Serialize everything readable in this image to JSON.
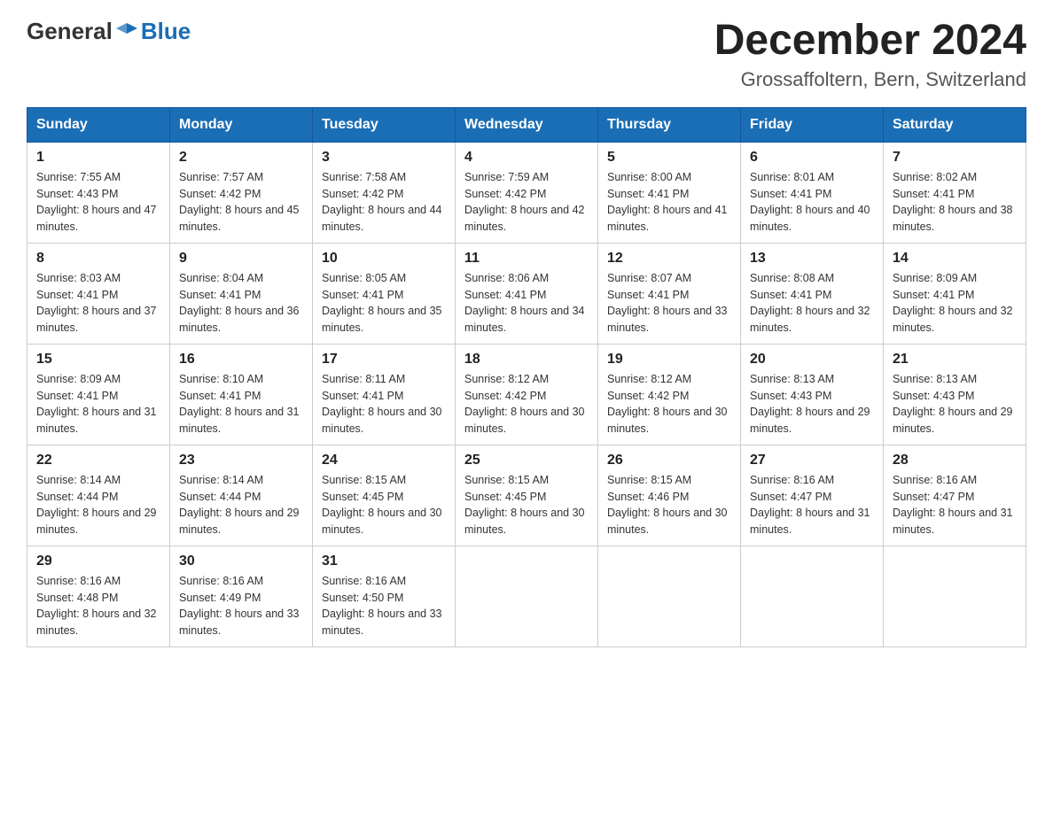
{
  "header": {
    "logo_general": "General",
    "logo_blue": "Blue",
    "month_title": "December 2024",
    "location": "Grossaffoltern, Bern, Switzerland"
  },
  "weekdays": [
    "Sunday",
    "Monday",
    "Tuesday",
    "Wednesday",
    "Thursday",
    "Friday",
    "Saturday"
  ],
  "weeks": [
    [
      {
        "day": "1",
        "sunrise": "7:55 AM",
        "sunset": "4:43 PM",
        "daylight": "8 hours and 47 minutes."
      },
      {
        "day": "2",
        "sunrise": "7:57 AM",
        "sunset": "4:42 PM",
        "daylight": "8 hours and 45 minutes."
      },
      {
        "day": "3",
        "sunrise": "7:58 AM",
        "sunset": "4:42 PM",
        "daylight": "8 hours and 44 minutes."
      },
      {
        "day": "4",
        "sunrise": "7:59 AM",
        "sunset": "4:42 PM",
        "daylight": "8 hours and 42 minutes."
      },
      {
        "day": "5",
        "sunrise": "8:00 AM",
        "sunset": "4:41 PM",
        "daylight": "8 hours and 41 minutes."
      },
      {
        "day": "6",
        "sunrise": "8:01 AM",
        "sunset": "4:41 PM",
        "daylight": "8 hours and 40 minutes."
      },
      {
        "day": "7",
        "sunrise": "8:02 AM",
        "sunset": "4:41 PM",
        "daylight": "8 hours and 38 minutes."
      }
    ],
    [
      {
        "day": "8",
        "sunrise": "8:03 AM",
        "sunset": "4:41 PM",
        "daylight": "8 hours and 37 minutes."
      },
      {
        "day": "9",
        "sunrise": "8:04 AM",
        "sunset": "4:41 PM",
        "daylight": "8 hours and 36 minutes."
      },
      {
        "day": "10",
        "sunrise": "8:05 AM",
        "sunset": "4:41 PM",
        "daylight": "8 hours and 35 minutes."
      },
      {
        "day": "11",
        "sunrise": "8:06 AM",
        "sunset": "4:41 PM",
        "daylight": "8 hours and 34 minutes."
      },
      {
        "day": "12",
        "sunrise": "8:07 AM",
        "sunset": "4:41 PM",
        "daylight": "8 hours and 33 minutes."
      },
      {
        "day": "13",
        "sunrise": "8:08 AM",
        "sunset": "4:41 PM",
        "daylight": "8 hours and 32 minutes."
      },
      {
        "day": "14",
        "sunrise": "8:09 AM",
        "sunset": "4:41 PM",
        "daylight": "8 hours and 32 minutes."
      }
    ],
    [
      {
        "day": "15",
        "sunrise": "8:09 AM",
        "sunset": "4:41 PM",
        "daylight": "8 hours and 31 minutes."
      },
      {
        "day": "16",
        "sunrise": "8:10 AM",
        "sunset": "4:41 PM",
        "daylight": "8 hours and 31 minutes."
      },
      {
        "day": "17",
        "sunrise": "8:11 AM",
        "sunset": "4:41 PM",
        "daylight": "8 hours and 30 minutes."
      },
      {
        "day": "18",
        "sunrise": "8:12 AM",
        "sunset": "4:42 PM",
        "daylight": "8 hours and 30 minutes."
      },
      {
        "day": "19",
        "sunrise": "8:12 AM",
        "sunset": "4:42 PM",
        "daylight": "8 hours and 30 minutes."
      },
      {
        "day": "20",
        "sunrise": "8:13 AM",
        "sunset": "4:43 PM",
        "daylight": "8 hours and 29 minutes."
      },
      {
        "day": "21",
        "sunrise": "8:13 AM",
        "sunset": "4:43 PM",
        "daylight": "8 hours and 29 minutes."
      }
    ],
    [
      {
        "day": "22",
        "sunrise": "8:14 AM",
        "sunset": "4:44 PM",
        "daylight": "8 hours and 29 minutes."
      },
      {
        "day": "23",
        "sunrise": "8:14 AM",
        "sunset": "4:44 PM",
        "daylight": "8 hours and 29 minutes."
      },
      {
        "day": "24",
        "sunrise": "8:15 AM",
        "sunset": "4:45 PM",
        "daylight": "8 hours and 30 minutes."
      },
      {
        "day": "25",
        "sunrise": "8:15 AM",
        "sunset": "4:45 PM",
        "daylight": "8 hours and 30 minutes."
      },
      {
        "day": "26",
        "sunrise": "8:15 AM",
        "sunset": "4:46 PM",
        "daylight": "8 hours and 30 minutes."
      },
      {
        "day": "27",
        "sunrise": "8:16 AM",
        "sunset": "4:47 PM",
        "daylight": "8 hours and 31 minutes."
      },
      {
        "day": "28",
        "sunrise": "8:16 AM",
        "sunset": "4:47 PM",
        "daylight": "8 hours and 31 minutes."
      }
    ],
    [
      {
        "day": "29",
        "sunrise": "8:16 AM",
        "sunset": "4:48 PM",
        "daylight": "8 hours and 32 minutes."
      },
      {
        "day": "30",
        "sunrise": "8:16 AM",
        "sunset": "4:49 PM",
        "daylight": "8 hours and 33 minutes."
      },
      {
        "day": "31",
        "sunrise": "8:16 AM",
        "sunset": "4:50 PM",
        "daylight": "8 hours and 33 minutes."
      },
      null,
      null,
      null,
      null
    ]
  ]
}
